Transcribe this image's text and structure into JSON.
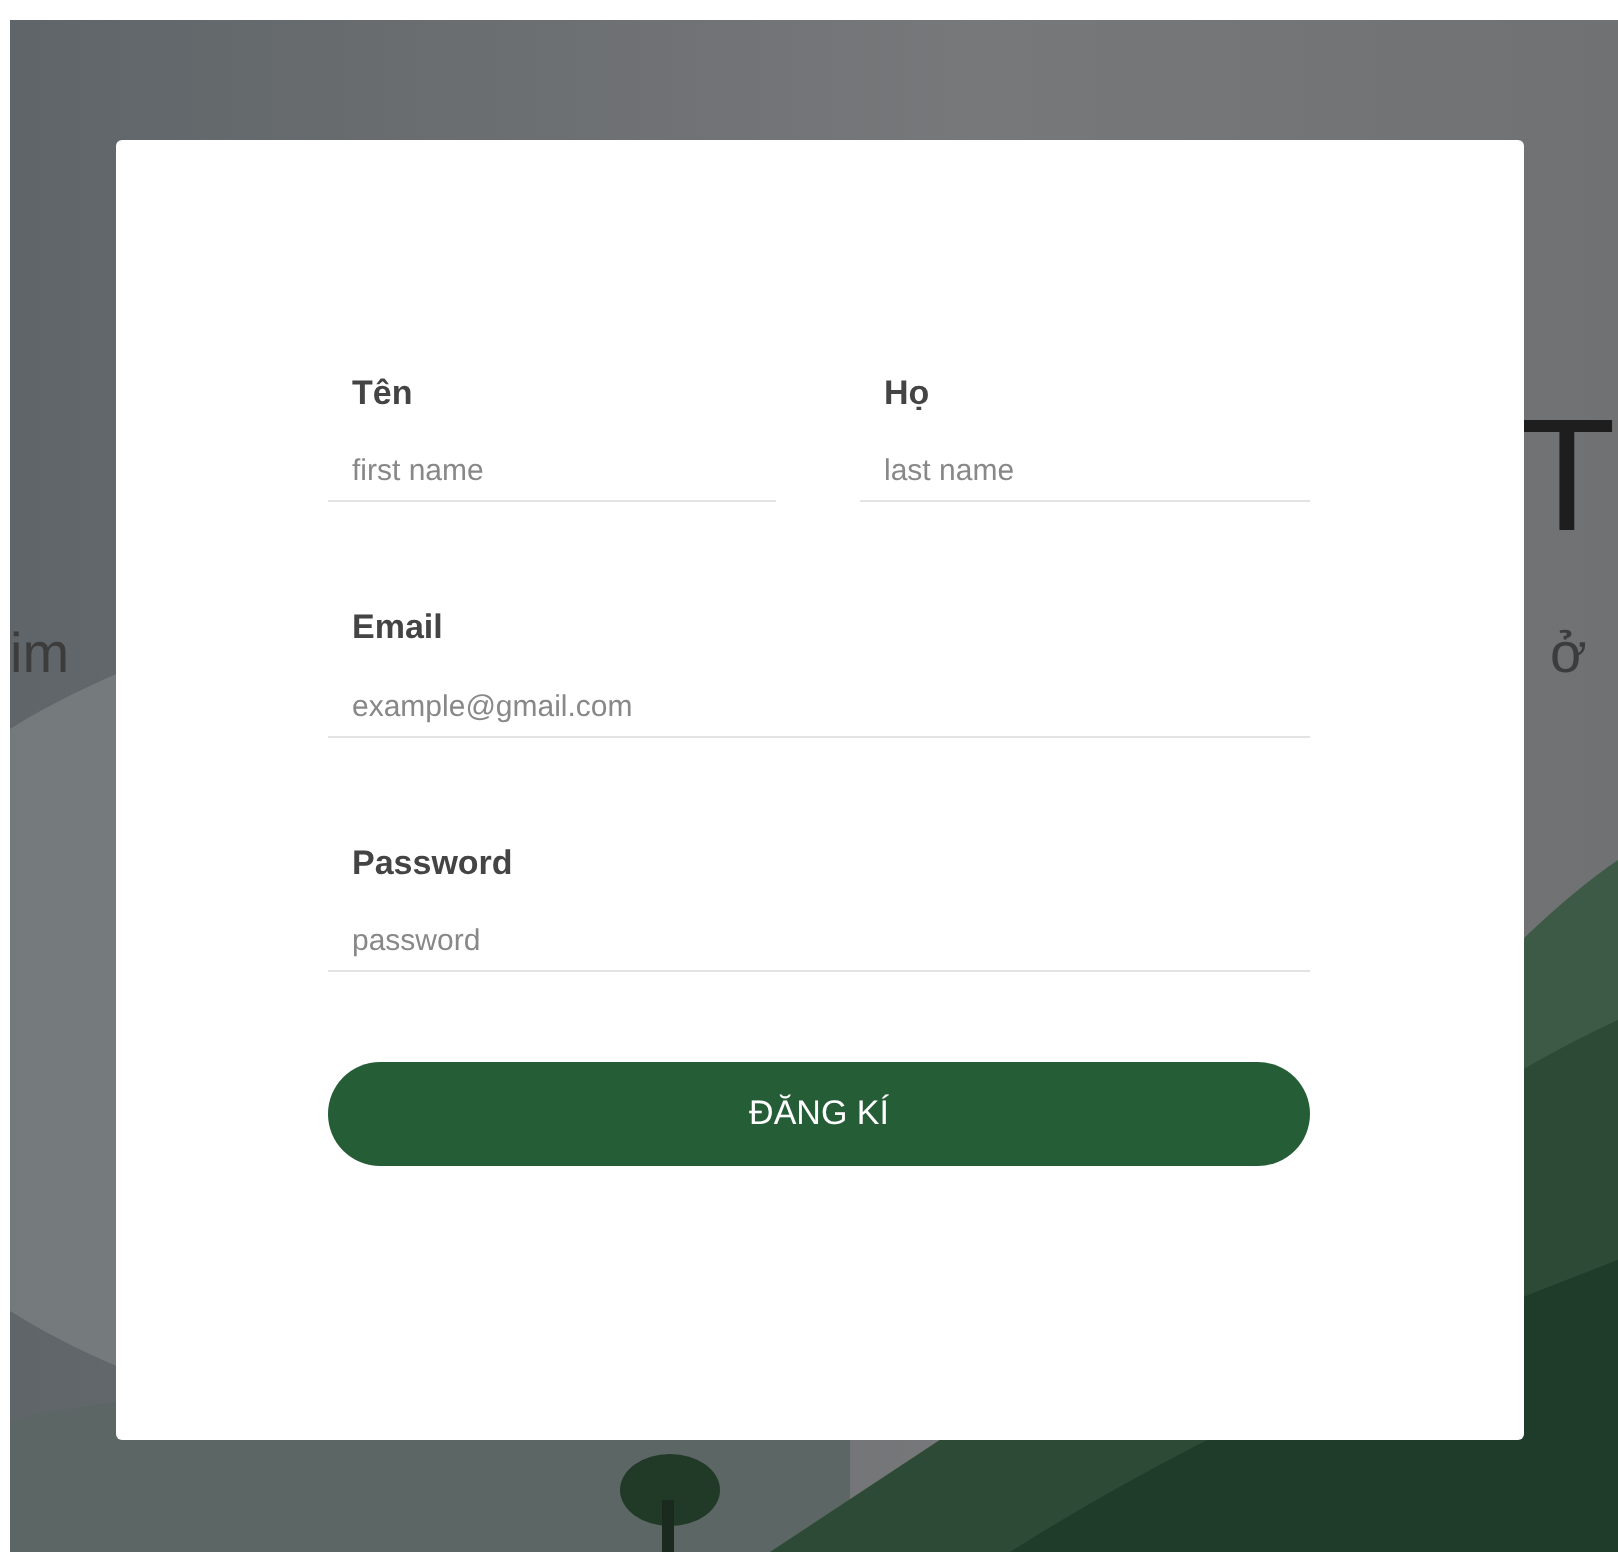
{
  "background": {
    "kind": "picture",
    "heading_right": "T",
    "subtitle_left": "im",
    "subtitle_right": "ở"
  },
  "form": {
    "fields": [
      {
        "label": "Tên",
        "placeholder": "first name"
      },
      {
        "label": "Họ",
        "placeholder": "last name"
      },
      {
        "label": "Email",
        "placeholder": "example@gmail.com"
      },
      {
        "label": "Password",
        "placeholder": "password"
      }
    ],
    "submit": "ĐĂNG KÍ"
  }
}
